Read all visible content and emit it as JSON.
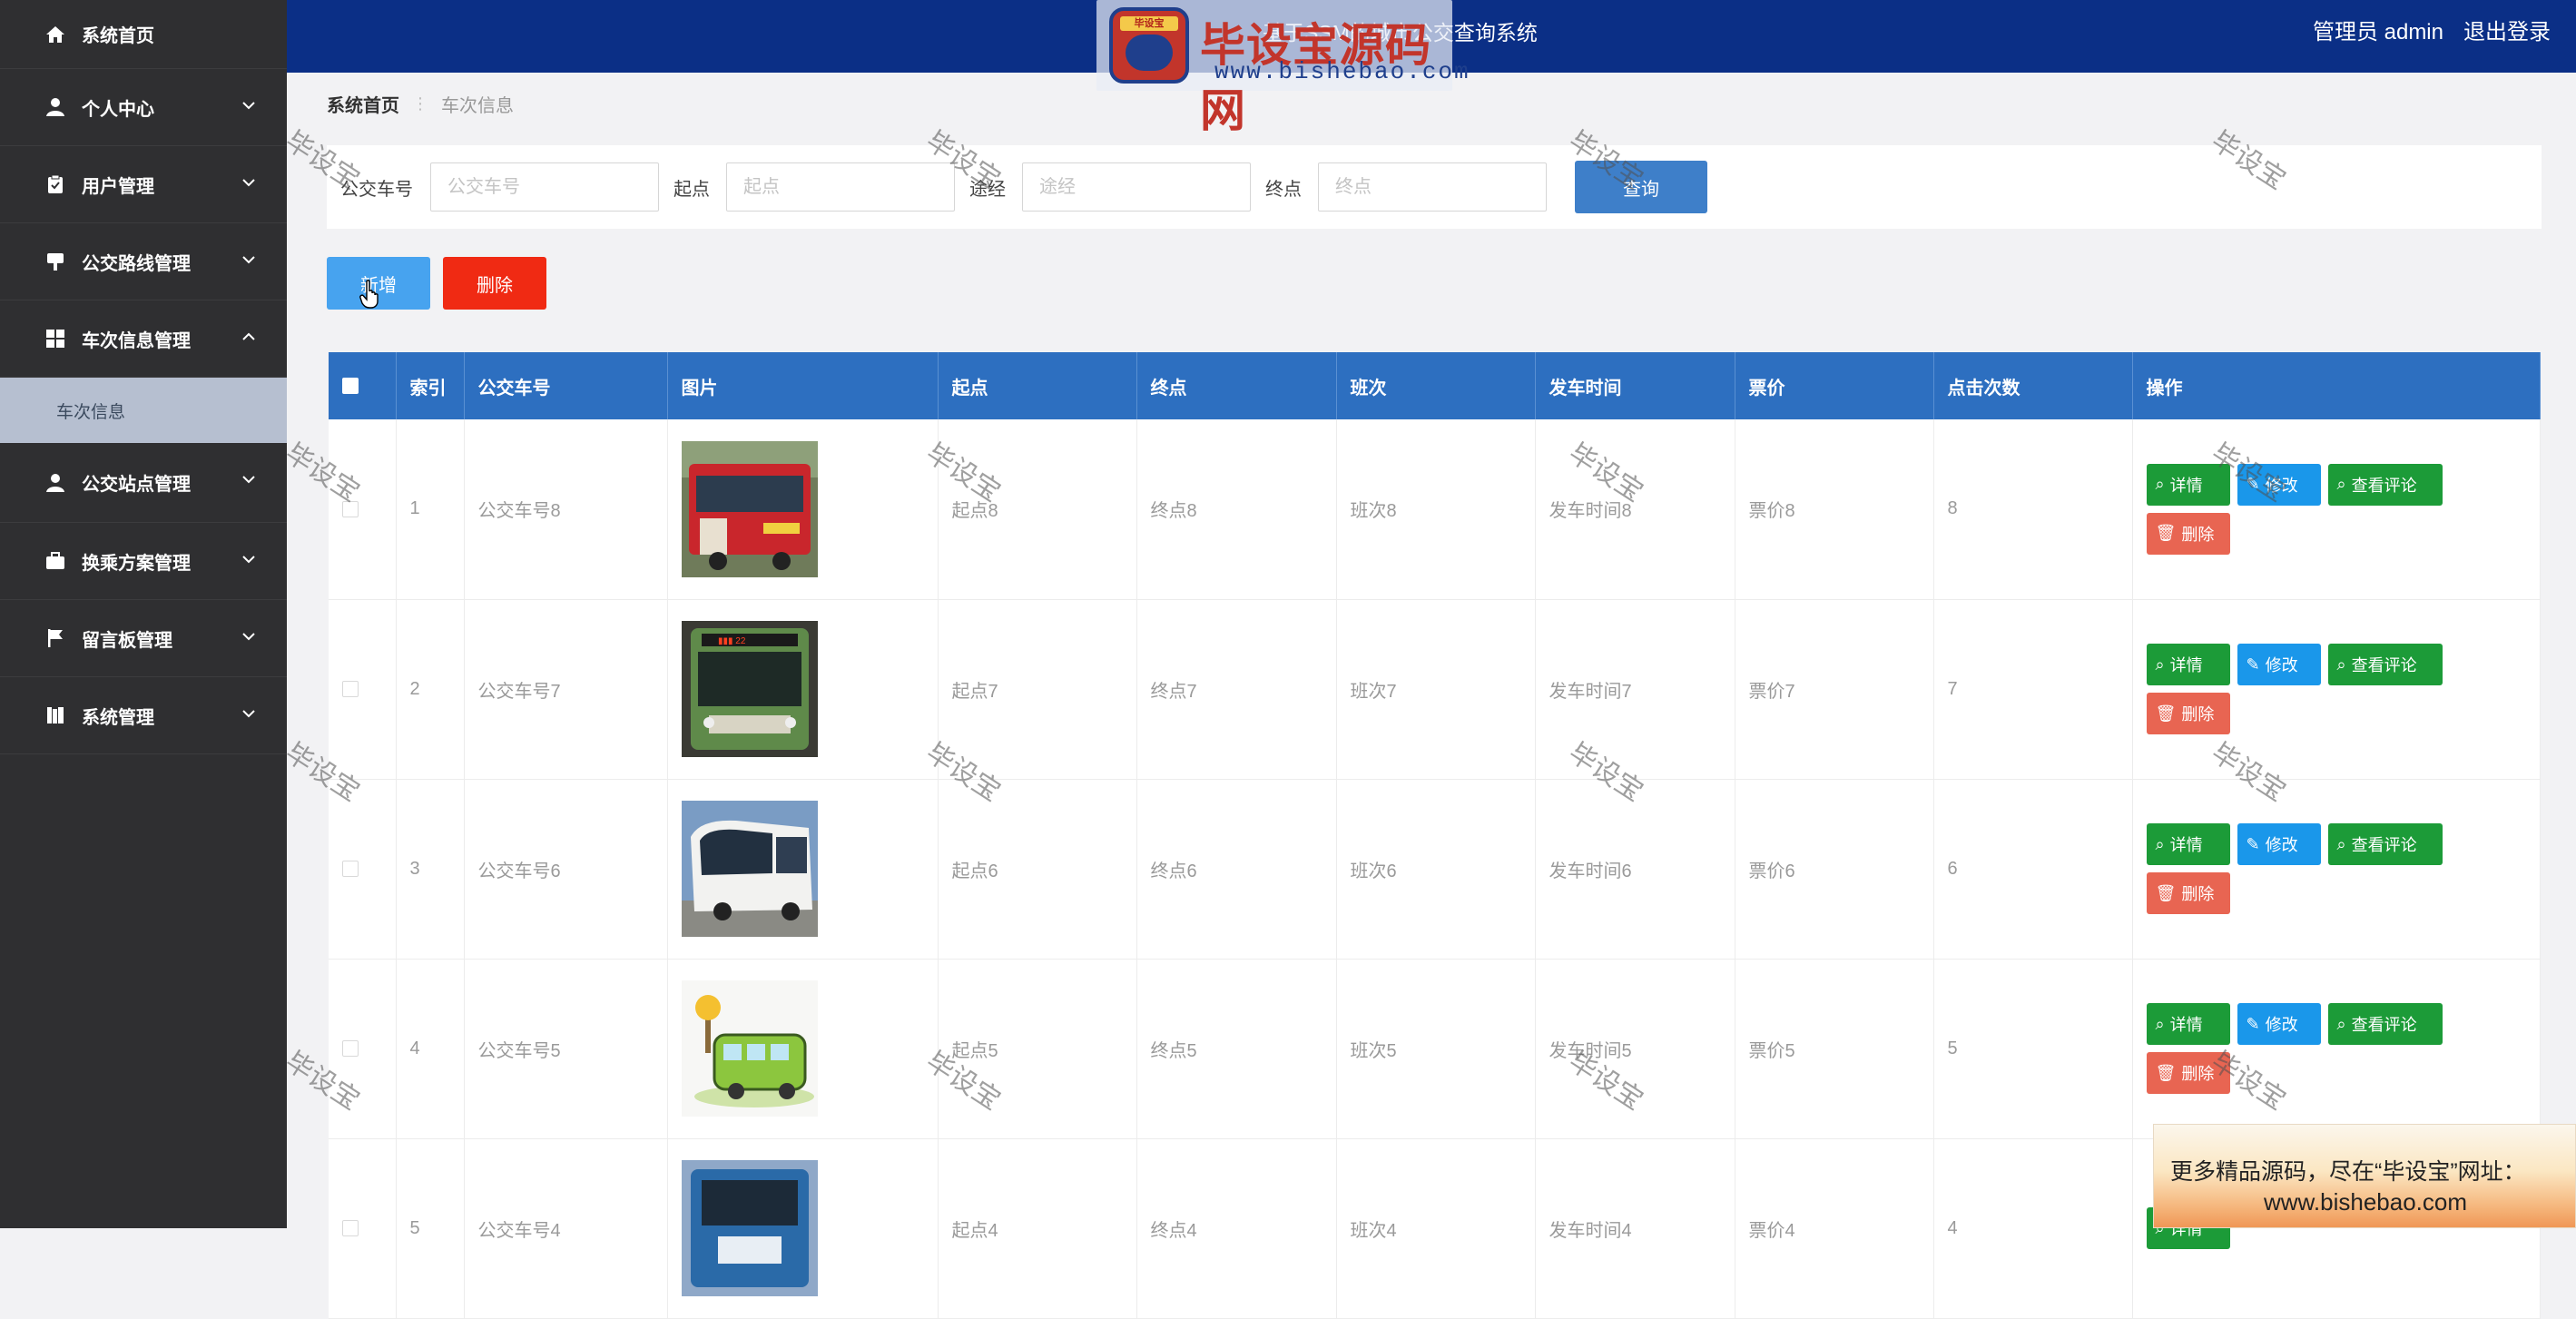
{
  "header": {
    "title": "基于SSM的城市公交查询系统",
    "admin_label": "管理员 admin",
    "logout_label": "退出登录"
  },
  "logo_watermark": {
    "badge_text": "毕设宝",
    "big_text": "毕设宝源码网",
    "url": "www.bishebao.com"
  },
  "sidebar": {
    "home": "系统首页",
    "items": [
      {
        "label": "个人中心",
        "icon": "user-icon"
      },
      {
        "label": "用户管理",
        "icon": "clipboard-icon"
      },
      {
        "label": "公交路线管理",
        "icon": "sign-icon"
      },
      {
        "label": "车次信息管理",
        "icon": "grid-icon",
        "expanded": true
      },
      {
        "label": "公交站点管理",
        "icon": "user-icon"
      },
      {
        "label": "换乘方案管理",
        "icon": "briefcase-icon"
      },
      {
        "label": "留言板管理",
        "icon": "flag-icon"
      },
      {
        "label": "系统管理",
        "icon": "book-icon"
      }
    ],
    "sub_item": "车次信息"
  },
  "breadcrumb": {
    "home": "系统首页",
    "current": "车次信息"
  },
  "search": {
    "bus_no_label": "公交车号",
    "bus_no_placeholder": "公交车号",
    "start_label": "起点",
    "start_placeholder": "起点",
    "via_label": "途经",
    "via_placeholder": "途经",
    "end_label": "终点",
    "end_placeholder": "终点",
    "query_button": "查询"
  },
  "actions": {
    "add": "新增",
    "delete": "删除"
  },
  "table": {
    "headers": [
      "索引",
      "公交车号",
      "图片",
      "起点",
      "终点",
      "班次",
      "发车时间",
      "票价",
      "点击次数",
      "操作"
    ],
    "op_labels": {
      "detail": "详情",
      "edit": "修改",
      "comments": "查看评论",
      "delete": "删除"
    },
    "rows": [
      {
        "index": "1",
        "bus_no": "公交车号8",
        "start": "起点8",
        "end": "终点8",
        "shift": "班次8",
        "depart": "发车时间8",
        "price": "票价8",
        "clicks": "8"
      },
      {
        "index": "2",
        "bus_no": "公交车号7",
        "start": "起点7",
        "end": "终点7",
        "shift": "班次7",
        "depart": "发车时间7",
        "price": "票价7",
        "clicks": "7"
      },
      {
        "index": "3",
        "bus_no": "公交车号6",
        "start": "起点6",
        "end": "终点6",
        "shift": "班次6",
        "depart": "发车时间6",
        "price": "票价6",
        "clicks": "6"
      },
      {
        "index": "4",
        "bus_no": "公交车号5",
        "start": "起点5",
        "end": "终点5",
        "shift": "班次5",
        "depart": "发车时间5",
        "price": "票价5",
        "clicks": "5"
      },
      {
        "index": "5",
        "bus_no": "公交车号4",
        "start": "起点4",
        "end": "终点4",
        "shift": "班次4",
        "depart": "发车时间4",
        "price": "票价4",
        "clicks": "4"
      }
    ]
  },
  "watermark_text": "毕设宝",
  "promo": {
    "line1": "更多精品源码，尽在“毕设宝”网址：",
    "line2": "www.bishebao.com"
  },
  "colors": {
    "sidebar_bg": "#2f2f31",
    "header_bg": "#0b2f86",
    "table_header_bg": "#2d6fc0",
    "add_button": "#47a3ef",
    "delete_button": "#f02a13",
    "detail_button": "#1c9b38",
    "edit_button": "#1a97ea",
    "row_delete_button": "#e86552"
  }
}
